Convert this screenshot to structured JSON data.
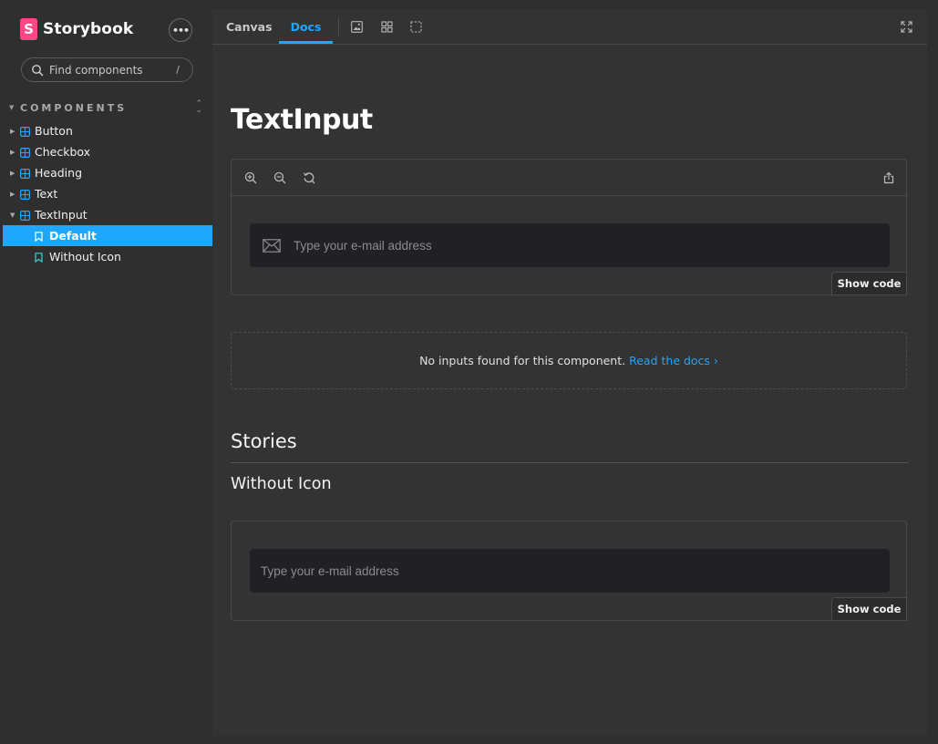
{
  "sidebar": {
    "brand": "Storybook",
    "logo_letter": "S",
    "menu_label": "•••",
    "search_placeholder": "Find components",
    "search_shortcut": "/",
    "section_label": "COMPONENTS",
    "items": [
      {
        "label": "Button"
      },
      {
        "label": "Checkbox"
      },
      {
        "label": "Heading"
      },
      {
        "label": "Text"
      },
      {
        "label": "TextInput"
      }
    ],
    "stories": [
      {
        "label": "Default",
        "selected": true
      },
      {
        "label": "Without Icon",
        "selected": false
      }
    ]
  },
  "toolbar": {
    "tabs": [
      {
        "label": "Canvas",
        "active": false
      },
      {
        "label": "Docs",
        "active": true
      }
    ]
  },
  "docs": {
    "title": "TextInput",
    "primary_preview": {
      "placeholder": "Type your e-mail address",
      "show_code": "Show code"
    },
    "no_inputs_text": "No inputs found for this component.",
    "read_docs_link": "Read the docs",
    "stories_heading": "Stories",
    "story_heading": "Without Icon",
    "secondary_preview": {
      "placeholder": "Type your e-mail address",
      "show_code": "Show code"
    }
  },
  "colors": {
    "accent": "#1ea7fd",
    "brand": "#ff4785",
    "background": "#2f2f2f",
    "panel": "#333333",
    "input": "#212125"
  }
}
